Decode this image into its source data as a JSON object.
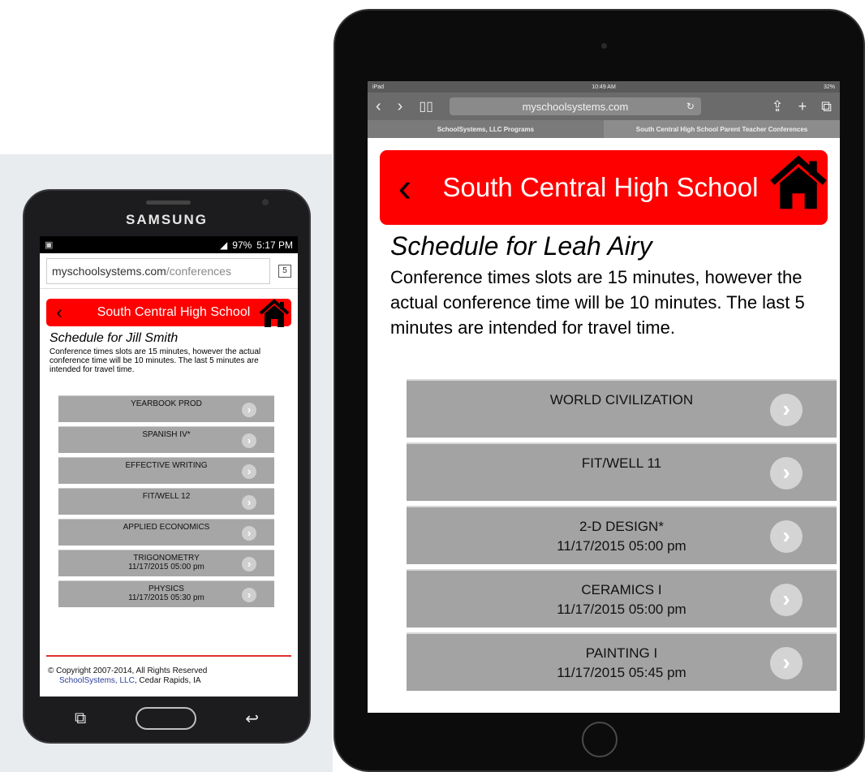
{
  "phone": {
    "brand": "SAMSUNG",
    "status": {
      "battery": "97%",
      "time": "5:17 PM"
    },
    "browser": {
      "url_host": "myschoolsystems.com",
      "url_path": "/conferences",
      "tab_count": "5"
    },
    "header": {
      "title": "South Central High School"
    },
    "schedule_title": "Schedule for Jill Smith",
    "note": "Conference times slots are 15 minutes, however the actual conference time will be 10 minutes. The last 5 minutes are intended for travel time.",
    "courses": [
      {
        "name": "YEARBOOK PROD",
        "time": ""
      },
      {
        "name": "SPANISH IV*",
        "time": ""
      },
      {
        "name": "EFFECTIVE WRITING",
        "time": ""
      },
      {
        "name": "FIT/WELL 12",
        "time": ""
      },
      {
        "name": "APPLIED ECONOMICS",
        "time": ""
      },
      {
        "name": "TRIGONOMETRY",
        "time": "11/17/2015 05:00 pm"
      },
      {
        "name": "PHYSICS",
        "time": "11/17/2015 05:30 pm"
      }
    ],
    "footer": {
      "copyright": "© Copyright 2007-2014, All Rights Reserved",
      "company": "SchoolSystems, LLC",
      "location": ", Cedar Rapids, IA"
    }
  },
  "tablet": {
    "status": {
      "device": "iPad",
      "time": "10:49 AM",
      "battery": "32%"
    },
    "browser": {
      "url": "myschoolsystems.com",
      "tabs": [
        "SchoolSystems, LLC Programs",
        "South Central High School Parent Teacher Conferences"
      ]
    },
    "header": {
      "title": "South Central High School"
    },
    "schedule_title": "Schedule for Leah Airy",
    "note": "Conference times slots are 15 minutes, however the actual conference time will be 10 minutes. The last 5 minutes are intended for travel time.",
    "courses": [
      {
        "name": "WORLD CIVILIZATION",
        "time": ""
      },
      {
        "name": "FIT/WELL 11",
        "time": ""
      },
      {
        "name": "2-D DESIGN*",
        "time": "11/17/2015 05:00 pm"
      },
      {
        "name": "CERAMICS I",
        "time": "11/17/2015 05:00 pm"
      },
      {
        "name": "PAINTING I",
        "time": "11/17/2015 05:45 pm"
      }
    ]
  },
  "colors": {
    "accent_red": "#ff0000",
    "item_gray": "#a6a6a6",
    "link_blue": "#2b3f9a"
  },
  "icons": [
    "back-chevron-icon",
    "home-icon",
    "chevron-right-icon",
    "tabs-icon",
    "bookmarks-icon",
    "share-icon",
    "plus-icon",
    "reload-icon"
  ]
}
